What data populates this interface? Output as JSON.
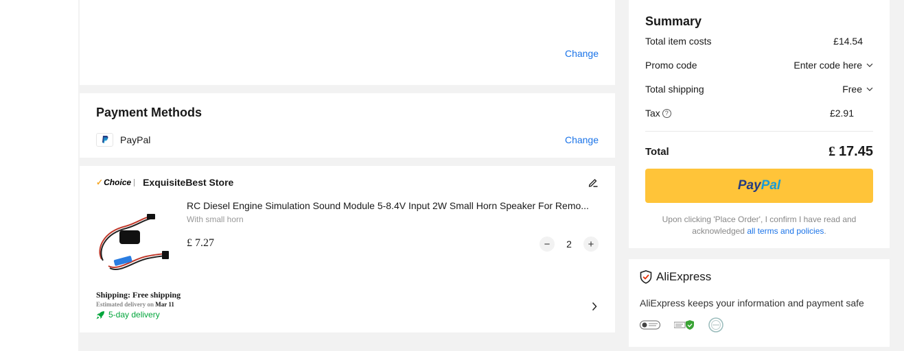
{
  "address": {
    "change_label": "Change"
  },
  "payment": {
    "title": "Payment Methods",
    "method": "PayPal",
    "method_icon": "paypal-icon",
    "change_label": "Change"
  },
  "store": {
    "badge": "Choice",
    "name": "ExquisiteBest Store",
    "item": {
      "title": "RC Diesel Engine Simulation Sound Module 5-8.4V Input 2W Small Horn Speaker For Remo...",
      "variant": "With small horn",
      "price": "£ 7.27",
      "quantity": "2"
    },
    "shipping": {
      "label": "Shipping: Free shipping",
      "estimated_prefix": "Estimated delivery on",
      "estimated_date": "Mar 11",
      "delivery_speed": "5-day delivery"
    }
  },
  "summary": {
    "title": "Summary",
    "rows": {
      "item_costs": {
        "label": "Total item costs",
        "value": "£14.54"
      },
      "promo": {
        "label": "Promo code",
        "value": "Enter code here"
      },
      "shipping": {
        "label": "Total shipping",
        "value": "Free"
      },
      "tax": {
        "label": "Tax",
        "value": "£2.91"
      }
    },
    "total": {
      "label": "Total",
      "currency": "£",
      "amount": "17.45"
    },
    "pay_button": {
      "part1": "Pay",
      "part2": "Pal"
    },
    "terms": {
      "text": "Upon clicking 'Place Order', I confirm I have read and acknowledged",
      "link": "all terms and policies",
      "end": "."
    }
  },
  "safety": {
    "brand": "AliExpress",
    "message": "AliExpress keeps your information and payment safe"
  },
  "colors": {
    "accent_link": "#1a73e8",
    "paypal_button": "#ffc439",
    "delivery_green": "#00a53a",
    "page_bg": "#f2f2f2"
  }
}
